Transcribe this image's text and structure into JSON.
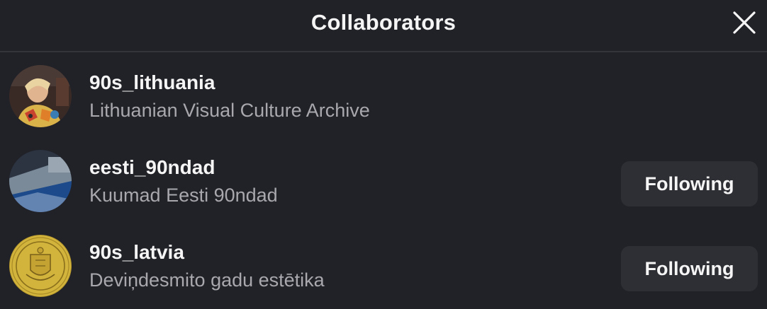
{
  "header": {
    "title": "Collaborators",
    "close_icon": "close-icon"
  },
  "collaborators": [
    {
      "username": "90s_lithuania",
      "fullname": "Lithuanian Visual Culture Archive",
      "avatar_icon": "avatar-photo",
      "button_label": ""
    },
    {
      "username": "eesti_90ndad",
      "fullname": "Kuumad Eesti 90ndad",
      "avatar_icon": "avatar-photo",
      "button_label": "Following"
    },
    {
      "username": "90s_latvia",
      "fullname": "Deviņdesmito gadu estētika",
      "avatar_icon": "avatar-coin",
      "button_label": "Following"
    }
  ],
  "colors": {
    "background": "#212228",
    "button_background": "#2e2f35",
    "secondary_text": "#a8a8ad",
    "divider": "#34353b"
  }
}
